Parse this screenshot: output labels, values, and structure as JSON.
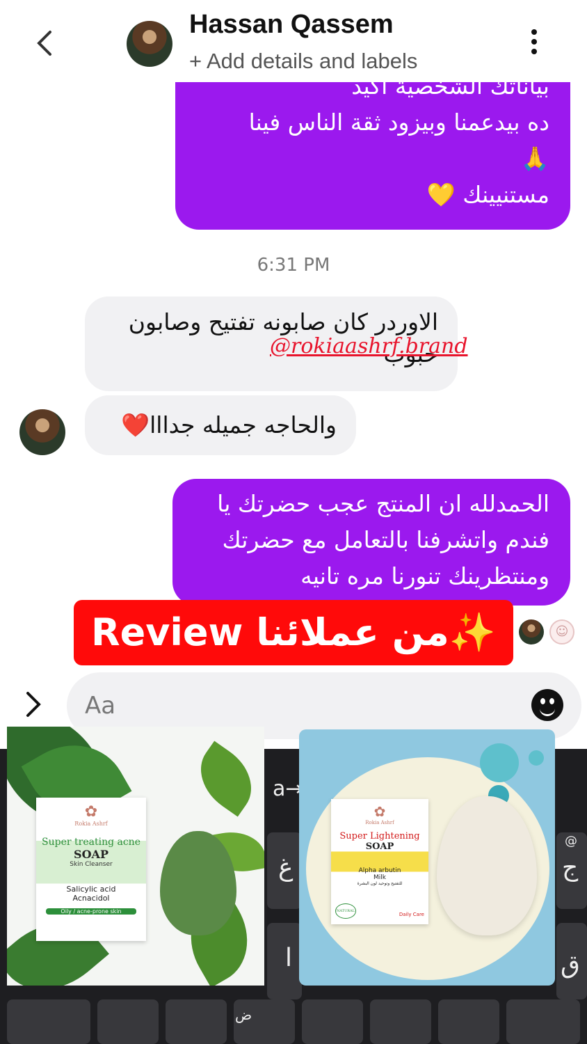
{
  "header": {
    "contact_name": "Hassan Qassem",
    "subtitle": "+ Add details and labels",
    "back_icon": "chevron-left-icon",
    "menu_icon": "more-vertical-icon"
  },
  "messages": [
    {
      "from": "me",
      "lines": [
        "بياناتك الشخصية أكيد",
        "ده بيدعمنا وبيزود ثقة الناس فينا",
        "🙏",
        "مستنيينك 💛"
      ]
    },
    {
      "timestamp": "6:31 PM"
    },
    {
      "from": "them",
      "text": "الاوردر كان صابونه تفتيح وصابون حبوب"
    },
    {
      "from": "them",
      "text": "والحاجه جميله جدااا❤️"
    },
    {
      "from": "me",
      "text": "الحمدلله ان المنتج عجب حضرتك يا فندم واتشرفنا بالتعامل مع حضرتك ومنتظرينك تنورنا مره تانيه"
    }
  ],
  "watermark": "@rokiaashrf.brand",
  "banner": "Review من عملائنا✨🫰🏻",
  "composer": {
    "placeholder": "Aa",
    "expand_icon": "chevron-right-icon",
    "emoji_icon": "smiley-icon"
  },
  "keyboard": {
    "keys": [
      "a→",
      "غ",
      "ج",
      "ا",
      "ق",
      "ض",
      "@"
    ]
  },
  "products": [
    {
      "title": "Super treating acne",
      "type": "SOAP",
      "subtitle": "Skin Cleanser",
      "ingredients": "Salicylic acid",
      "ingredients2": "Acnacidol",
      "footer": "Oily / acne-prone skin",
      "brand": "Rokia Ashrf"
    },
    {
      "title": "Super Lightening",
      "type": "SOAP",
      "ingredients": "Alpha arbutin",
      "ingredients2": "Milk",
      "arabic": "للتفتيح وتوحيد لون البشرة",
      "badge": "NATURAL",
      "footer": "Daily Care",
      "brand": "Rokia Ashrf"
    }
  ],
  "colors": {
    "outgoing_bubble": "#9b19ee",
    "incoming_bubble": "#f1f1f3",
    "banner": "#ff0a0a",
    "watermark": "#e8142c"
  }
}
